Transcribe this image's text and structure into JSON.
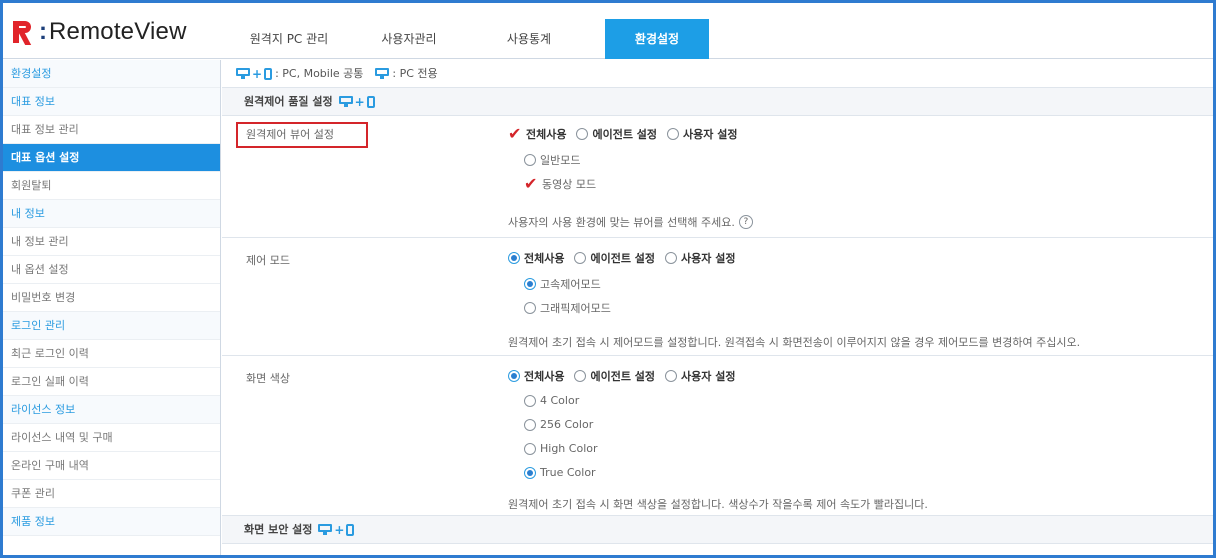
{
  "logo": {
    "symbol": "R",
    "separator": ":",
    "name": "RemoteView"
  },
  "nav": {
    "tabs": [
      {
        "label": "원격지 PC 관리"
      },
      {
        "label": "사용자관리"
      },
      {
        "label": "사용통계"
      },
      {
        "label": "환경설정"
      }
    ],
    "active_index": 3
  },
  "sidebar": {
    "items": [
      {
        "label": "환경설정",
        "type": "section"
      },
      {
        "label": "대표 정보",
        "type": "section"
      },
      {
        "label": "대표 정보 관리",
        "type": "item"
      },
      {
        "label": "대표 옵션 설정",
        "type": "item",
        "active": true
      },
      {
        "label": "회원탈퇴",
        "type": "item"
      },
      {
        "label": "내 정보",
        "type": "section"
      },
      {
        "label": "내 정보 관리",
        "type": "item"
      },
      {
        "label": "내 옵션 설정",
        "type": "item"
      },
      {
        "label": "비밀번호 변경",
        "type": "item"
      },
      {
        "label": "로그인 관리",
        "type": "section"
      },
      {
        "label": "최근 로그인 이력",
        "type": "item"
      },
      {
        "label": "로그인 실패 이력",
        "type": "item"
      },
      {
        "label": "라이선스 정보",
        "type": "section"
      },
      {
        "label": "라이선스 내역 및 구매",
        "type": "item"
      },
      {
        "label": "온라인 구매 내역",
        "type": "item"
      },
      {
        "label": "쿠폰 관리",
        "type": "item"
      },
      {
        "label": "제품 정보",
        "type": "section"
      }
    ]
  },
  "legend": {
    "common_text": ": PC, Mobile 공통",
    "pc_text": ": PC 전용"
  },
  "sections": {
    "quality_title": "원격제어 품질 설정",
    "security_title": "화면 보안 설정"
  },
  "viewer_setting": {
    "label": "원격제어 뷰어 설정",
    "scope_options": [
      "전체사용",
      "에이전트 설정",
      "사용자 설정"
    ],
    "scope_selected": "전체사용",
    "sub_options": [
      "일반모드",
      "동영상 모드"
    ],
    "sub_selected": "동영상 모드",
    "hint": "사용자의 사용 환경에 맞는 뷰어를 선택해 주세요.",
    "help_icon": "?"
  },
  "control_mode": {
    "label": "제어 모드",
    "scope_options": [
      "전체사용",
      "에이전트 설정",
      "사용자 설정"
    ],
    "scope_selected": "전체사용",
    "sub_options": [
      "고속제어모드",
      "그래픽제어모드"
    ],
    "sub_selected": "고속제어모드",
    "hint": "원격제어 초기 접속 시 제어모드를 설정합니다. 원격접속 시 화면전송이 이루어지지 않을 경우 제어모드를 변경하여 주십시오."
  },
  "screen_color": {
    "label": "화면 색상",
    "scope_options": [
      "전체사용",
      "에이전트 설정",
      "사용자 설정"
    ],
    "scope_selected": "전체사용",
    "sub_options": [
      "4 Color",
      "256 Color",
      "High Color",
      "True Color"
    ],
    "sub_selected": "True Color",
    "hint": "원격제어 초기 접속 시 화면 색상을 설정합니다. 색상수가 작을수록 제어 속도가 빨라집니다."
  },
  "colors": {
    "accent": "#1d9ee6",
    "check_red": "#d4252a",
    "brand_red": "#e1242a",
    "brand_navy": "#1d3f7a"
  }
}
